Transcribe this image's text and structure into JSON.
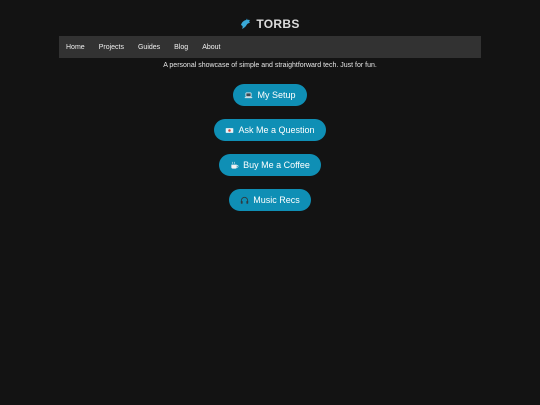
{
  "header": {
    "logo_icon": "dolphin-icon",
    "title": "TORBS"
  },
  "nav": {
    "items": [
      {
        "label": "Home"
      },
      {
        "label": "Projects"
      },
      {
        "label": "Guides"
      },
      {
        "label": "Blog"
      },
      {
        "label": "About"
      }
    ]
  },
  "tagline": "A personal showcase of simple and straightforward tech. Just for fun.",
  "links": [
    {
      "label": "My Setup",
      "icon": "laptop-icon"
    },
    {
      "label": "Ask Me a Question",
      "icon": "ticket-icon"
    },
    {
      "label": "Buy Me a Coffee",
      "icon": "coffee-icon"
    },
    {
      "label": "Music Recs",
      "icon": "headphones-icon"
    }
  ],
  "colors": {
    "background": "#131313",
    "navbar": "#323232",
    "accent": "#0f8fb5",
    "logo": "#39a9d8"
  }
}
